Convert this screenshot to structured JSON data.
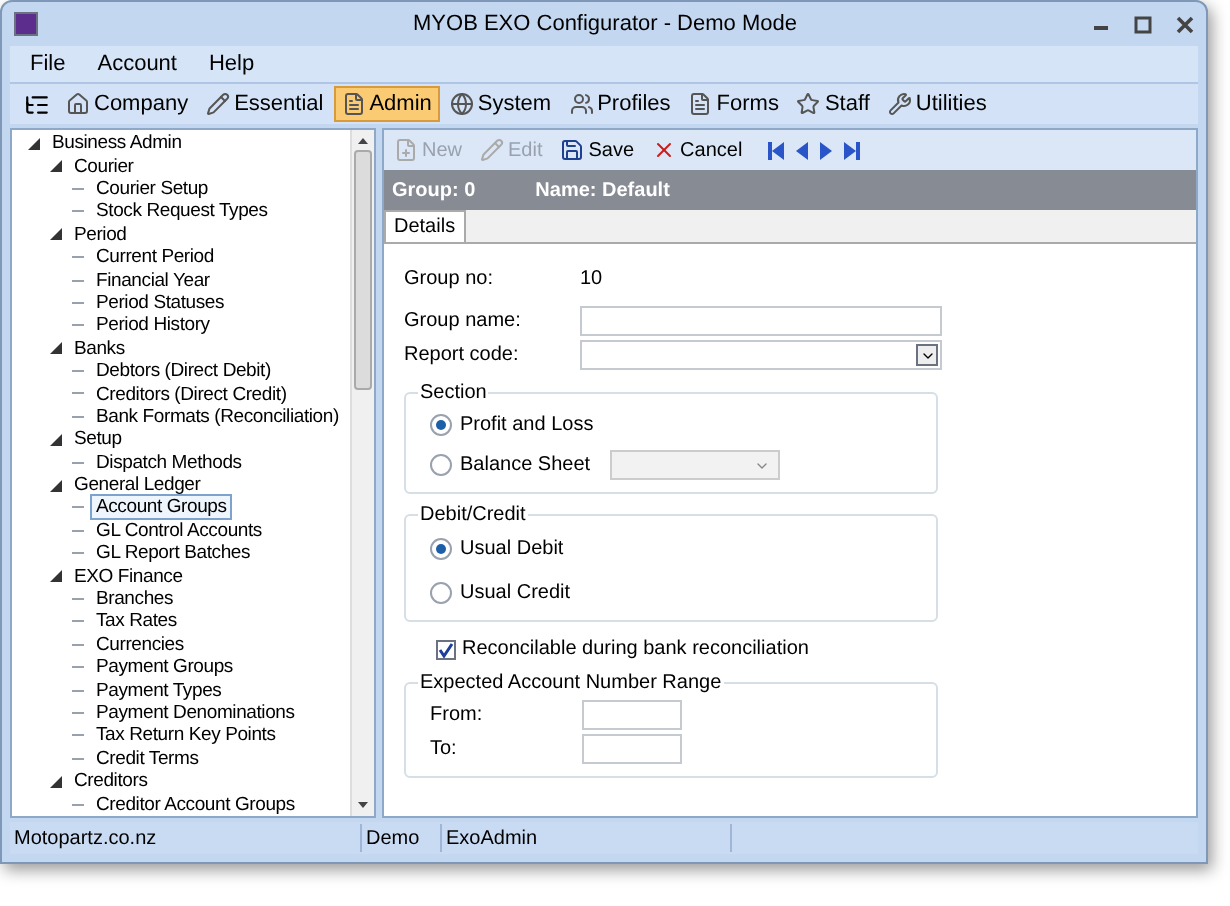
{
  "window": {
    "title": "MYOB EXO Configurator - Demo Mode"
  },
  "menu": [
    "File",
    "Account",
    "Help"
  ],
  "modules": [
    {
      "label": "Company",
      "selected": false
    },
    {
      "label": "Essential",
      "selected": false
    },
    {
      "label": "Admin",
      "selected": true
    },
    {
      "label": "System",
      "selected": false
    },
    {
      "label": "Profiles",
      "selected": false
    },
    {
      "label": "Forms",
      "selected": false
    },
    {
      "label": "Staff",
      "selected": false
    },
    {
      "label": "Utilities",
      "selected": false
    }
  ],
  "tree": [
    {
      "label": "Business Admin",
      "expanded": true,
      "selected": false,
      "children": [
        {
          "label": "Courier",
          "expanded": true,
          "selected": false,
          "children": [
            {
              "label": "Courier Setup",
              "selected": false
            },
            {
              "label": "Stock Request Types",
              "selected": false
            }
          ]
        },
        {
          "label": "Period",
          "expanded": true,
          "selected": false,
          "children": [
            {
              "label": "Current Period",
              "selected": false
            },
            {
              "label": "Financial Year",
              "selected": false
            },
            {
              "label": "Period Statuses",
              "selected": false
            },
            {
              "label": "Period History",
              "selected": false
            }
          ]
        },
        {
          "label": "Banks",
          "expanded": true,
          "selected": false,
          "children": [
            {
              "label": "Debtors (Direct Debit)",
              "selected": false
            },
            {
              "label": "Creditors (Direct Credit)",
              "selected": false
            },
            {
              "label": "Bank Formats (Reconciliation)",
              "selected": false
            }
          ]
        },
        {
          "label": "Setup",
          "expanded": true,
          "selected": false,
          "children": [
            {
              "label": "Dispatch Methods",
              "selected": false
            }
          ]
        },
        {
          "label": "General Ledger",
          "expanded": true,
          "selected": false,
          "children": [
            {
              "label": "Account Groups",
              "selected": true
            },
            {
              "label": "GL Control Accounts",
              "selected": false
            },
            {
              "label": "GL Report Batches",
              "selected": false
            }
          ]
        },
        {
          "label": "EXO Finance",
          "expanded": true,
          "selected": false,
          "children": [
            {
              "label": "Branches",
              "selected": false
            },
            {
              "label": "Tax Rates",
              "selected": false
            },
            {
              "label": "Currencies",
              "selected": false
            },
            {
              "label": "Payment Groups",
              "selected": false
            },
            {
              "label": "Payment Types",
              "selected": false
            },
            {
              "label": "Payment Denominations",
              "selected": false
            },
            {
              "label": "Tax Return Key Points",
              "selected": false
            },
            {
              "label": "Credit Terms",
              "selected": false
            }
          ]
        },
        {
          "label": "Creditors",
          "expanded": true,
          "selected": false,
          "children": [
            {
              "label": "Creditor Account Groups",
              "selected": false
            }
          ]
        }
      ]
    }
  ],
  "actions": [
    {
      "label": "New",
      "disabled": true,
      "kind": "new"
    },
    {
      "label": "Edit",
      "disabled": true,
      "kind": "edit"
    },
    {
      "label": "Save",
      "disabled": false,
      "kind": "save"
    },
    {
      "label": "Cancel",
      "disabled": false,
      "kind": "cancel"
    }
  ],
  "header": {
    "group": "Group: 0",
    "name": "Name: Default"
  },
  "tabs": [
    {
      "label": "Details",
      "selected": true
    }
  ],
  "form": {
    "group_no_label": "Group no:",
    "group_no": "10",
    "group_name_label": "Group name:",
    "report_code_label": "Report code:",
    "section": {
      "title": "Section",
      "options": [
        {
          "label": "Profit and Loss",
          "selected": true
        },
        {
          "label": "Balance Sheet",
          "selected": false
        }
      ]
    },
    "debit_credit": {
      "title": "Debit/Credit",
      "options": [
        {
          "label": "Usual Debit",
          "selected": true
        },
        {
          "label": "Usual Credit",
          "selected": false
        }
      ]
    },
    "reconcilable": {
      "label": "Reconcilable during bank reconciliation",
      "checked": true
    },
    "range": {
      "title": "Expected Account Number Range",
      "from_label": "From:",
      "to_label": "To:"
    }
  },
  "status_bar": [
    "Motopartz.co.nz",
    "Demo",
    "ExoAdmin"
  ]
}
